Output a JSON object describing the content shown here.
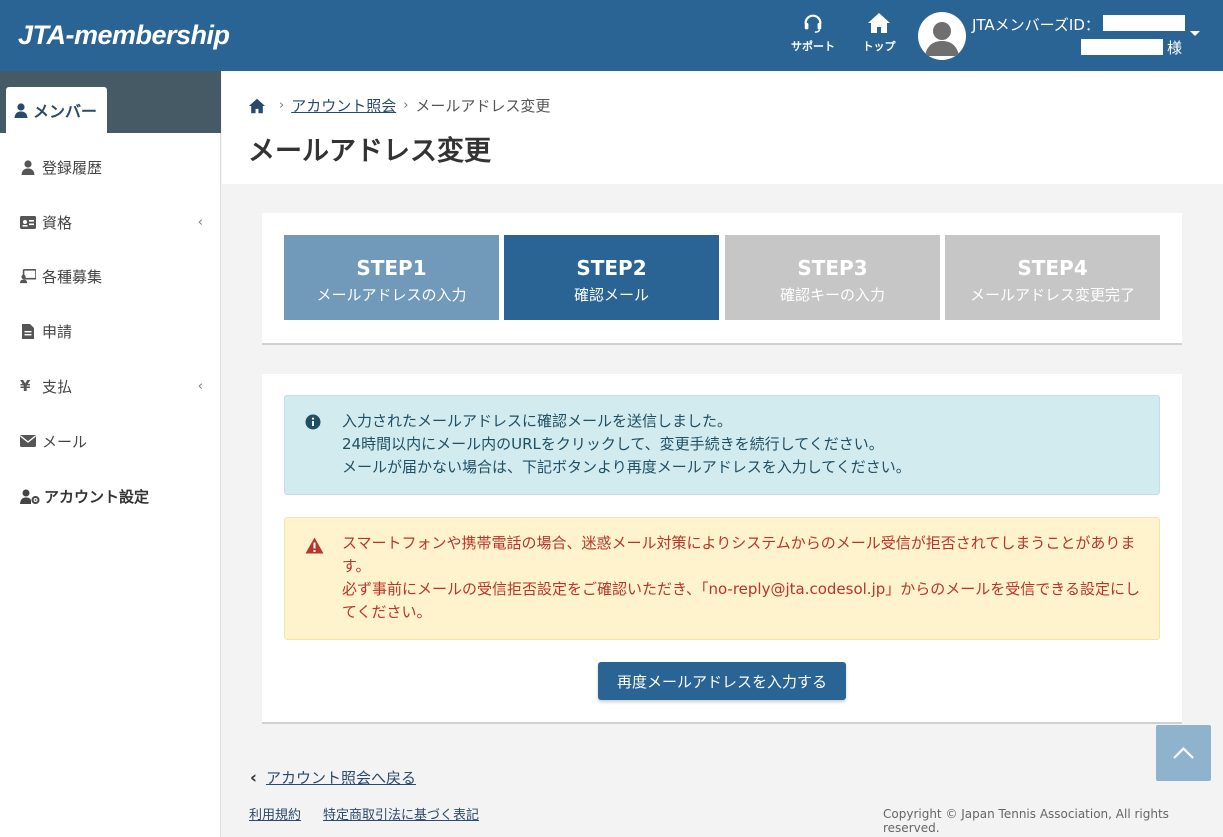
{
  "header": {
    "logo": "JTA-membership",
    "support_label": "サポート",
    "top_label": "トップ",
    "member_id_label": "JTAメンバーズID：",
    "honorific": "様"
  },
  "sidebar": {
    "active_tab": "メンバー",
    "items": [
      {
        "label": "登録履歴",
        "icon": "user-icon",
        "chevron": false
      },
      {
        "label": "資格",
        "icon": "id-card-icon",
        "chevron": true
      },
      {
        "label": "各種募集",
        "icon": "chalkboard-user-icon",
        "chevron": false
      },
      {
        "label": "申請",
        "icon": "file-icon",
        "chevron": false
      },
      {
        "label": "支払",
        "icon": "yen-icon",
        "chevron": true
      },
      {
        "label": "メール",
        "icon": "envelope-icon",
        "chevron": false
      },
      {
        "label": "アカウント設定",
        "icon": "user-gear-icon",
        "chevron": false
      }
    ]
  },
  "breadcrumb": {
    "link": "アカウント照会",
    "current": "メールアドレス変更"
  },
  "page_title": "メールアドレス変更",
  "steps": [
    {
      "num": "STEP1",
      "label": "メールアドレスの入力",
      "state": "done"
    },
    {
      "num": "STEP2",
      "label": "確認メール",
      "state": "active"
    },
    {
      "num": "STEP3",
      "label": "確認キーの入力",
      "state": "todo"
    },
    {
      "num": "STEP4",
      "label": "メールアドレス変更完了",
      "state": "todo"
    }
  ],
  "info_alert": {
    "line1": "入力されたメールアドレスに確認メールを送信しました。",
    "line2": "24時間以内にメール内のURLをクリックして、変更手続きを続行してください。",
    "line3": "メールが届かない場合は、下記ボタンより再度メールアドレスを入力してください。"
  },
  "warn_alert": {
    "line1": "スマートフォンや携帯電話の場合、迷惑メール対策によりシステムからのメール受信が拒否されてしまうことがあります。",
    "line2": "必ず事前にメールの受信拒否設定をご確認いただき、「no-reply@jta.codesol.jp」からのメールを受信できる設定にしてください。"
  },
  "reenter_button": "再度メールアドレスを入力する",
  "footer": {
    "back_link": "アカウント照会へ戻る",
    "terms": "利用規約",
    "commerce_law": "特定商取引法に基づく表記",
    "copyright": "Copyright © Japan Tennis Association, All rights reserved."
  },
  "colors": {
    "brand": "#2a6494",
    "step_done": "#7199b9",
    "step_active": "#2a6494",
    "step_todo": "#c6c6c6",
    "info_bg": "#d2ebef",
    "warn_bg": "#fff3cd",
    "warn_text": "#b8352c"
  }
}
